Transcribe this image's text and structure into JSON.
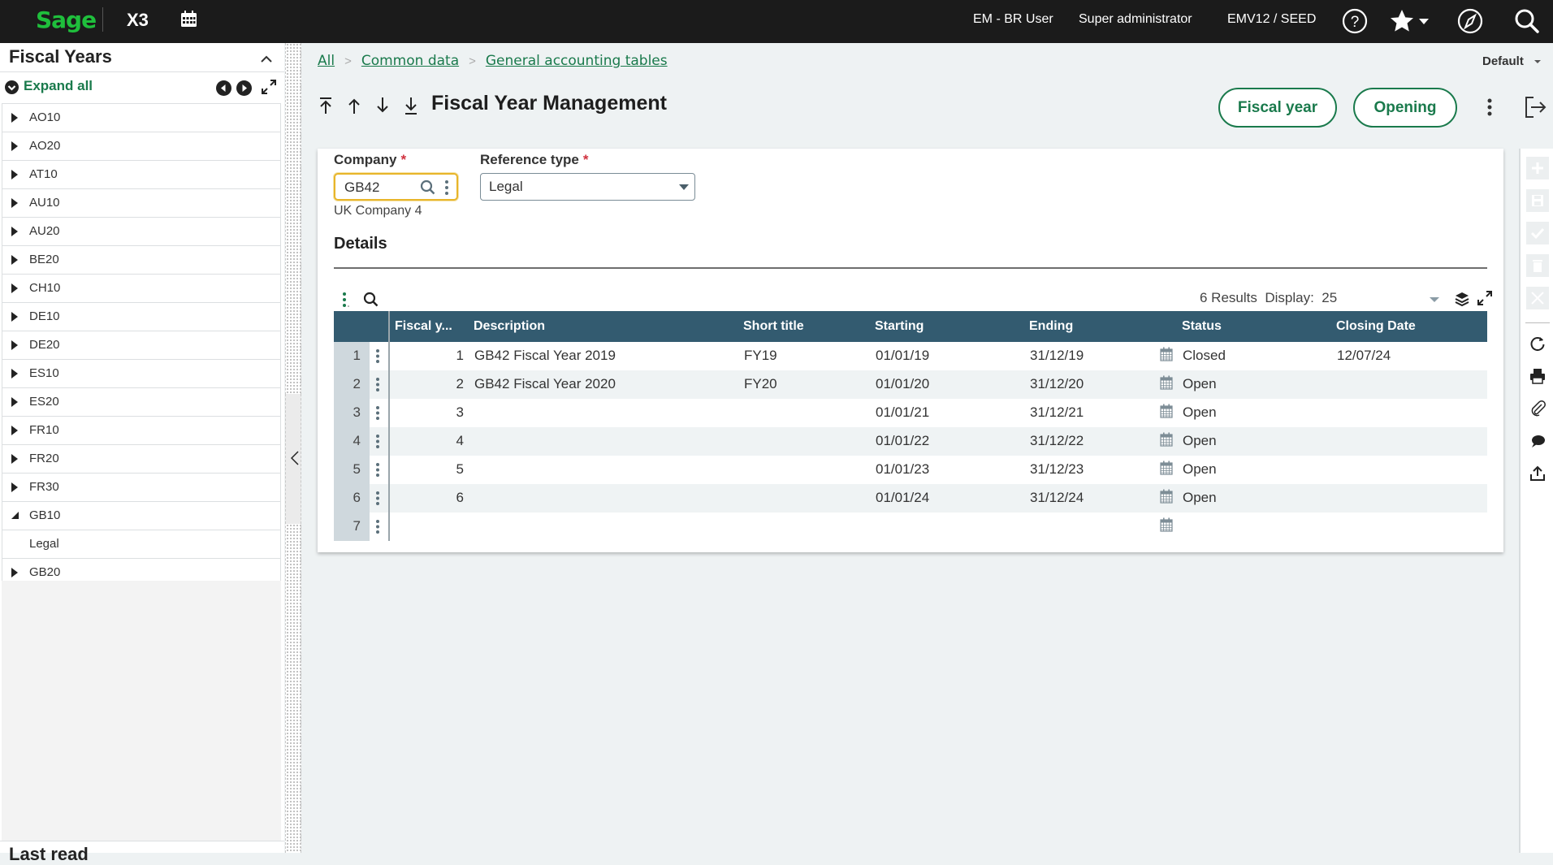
{
  "topbar": {
    "logo": "Sage",
    "product": "X3",
    "user": "EM - BR User",
    "role": "Super administrator",
    "endpoint": "EMV12 / SEED",
    "icons": [
      "calendar-icon",
      "help-icon",
      "star-icon",
      "compass-icon",
      "search-icon"
    ]
  },
  "left_panel": {
    "title": "Fiscal Years",
    "expand_all": "Expand all",
    "tree": [
      {
        "label": "AO10",
        "state": "collapsed"
      },
      {
        "label": "AO20",
        "state": "collapsed"
      },
      {
        "label": "AT10",
        "state": "collapsed"
      },
      {
        "label": "AU10",
        "state": "collapsed"
      },
      {
        "label": "AU20",
        "state": "collapsed"
      },
      {
        "label": "BE20",
        "state": "collapsed"
      },
      {
        "label": "CH10",
        "state": "collapsed"
      },
      {
        "label": "DE10",
        "state": "collapsed"
      },
      {
        "label": "DE20",
        "state": "collapsed"
      },
      {
        "label": "ES10",
        "state": "collapsed"
      },
      {
        "label": "ES20",
        "state": "collapsed"
      },
      {
        "label": "FR10",
        "state": "collapsed"
      },
      {
        "label": "FR20",
        "state": "collapsed"
      },
      {
        "label": "FR30",
        "state": "collapsed"
      },
      {
        "label": "GB10",
        "state": "expanded"
      },
      {
        "label": "Legal",
        "state": "child"
      },
      {
        "label": "GB20",
        "state": "collapsed"
      }
    ],
    "bottom_section_title": "Last read"
  },
  "breadcrumb": [
    "All",
    "Common data",
    "General accounting tables"
  ],
  "view_selector": "Default",
  "page_title": "Fiscal Year Management",
  "actions": {
    "fiscal_year": "Fiscal year",
    "opening": "Opening"
  },
  "form": {
    "company_label": "Company",
    "company_value": "GB42",
    "company_description": "UK Company 4",
    "reference_type_label": "Reference type",
    "reference_type_value": "Legal",
    "required_mark": "*",
    "details_title": "Details"
  },
  "grid": {
    "results_text": "6 Results",
    "display_label": "Display:",
    "display_value": "25",
    "columns": [
      "Fiscal y...",
      "Description",
      "Short title",
      "Starting",
      "Ending",
      "Status",
      "Closing Date"
    ],
    "rows": [
      {
        "num": "1",
        "fiscal_year": "1",
        "description": "GB42 Fiscal Year 2019",
        "short_title": "FY19",
        "starting": "01/01/19",
        "ending": "31/12/19",
        "status": "Closed",
        "closing_date": "12/07/24"
      },
      {
        "num": "2",
        "fiscal_year": "2",
        "description": "GB42 Fiscal Year 2020",
        "short_title": "FY20",
        "starting": "01/01/20",
        "ending": "31/12/20",
        "status": "Open",
        "closing_date": ""
      },
      {
        "num": "3",
        "fiscal_year": "3",
        "description": "",
        "short_title": "",
        "starting": "01/01/21",
        "ending": "31/12/21",
        "status": "Open",
        "closing_date": ""
      },
      {
        "num": "4",
        "fiscal_year": "4",
        "description": "",
        "short_title": "",
        "starting": "01/01/22",
        "ending": "31/12/22",
        "status": "Open",
        "closing_date": ""
      },
      {
        "num": "5",
        "fiscal_year": "5",
        "description": "",
        "short_title": "",
        "starting": "01/01/23",
        "ending": "31/12/23",
        "status": "Open",
        "closing_date": ""
      },
      {
        "num": "6",
        "fiscal_year": "6",
        "description": "",
        "short_title": "",
        "starting": "01/01/24",
        "ending": "31/12/24",
        "status": "Open",
        "closing_date": ""
      },
      {
        "num": "7",
        "fiscal_year": "",
        "description": "",
        "short_title": "",
        "starting": "",
        "ending": "",
        "status": "",
        "closing_date": ""
      }
    ]
  },
  "right_toolbar": {
    "disabled": [
      "add-icon",
      "save-icon",
      "check-icon",
      "delete-icon",
      "cancel-icon"
    ],
    "enabled": [
      "refresh-icon",
      "print-icon",
      "attachment-icon",
      "comment-icon",
      "export-icon"
    ]
  },
  "colors": {
    "brand_green": "#1fbf3c",
    "accent_green": "#1a7a4c",
    "grid_header": "#335b70",
    "focus_yellow": "#e8b52a",
    "required_red": "#d0323f",
    "topbar": "#1b1b1b"
  }
}
